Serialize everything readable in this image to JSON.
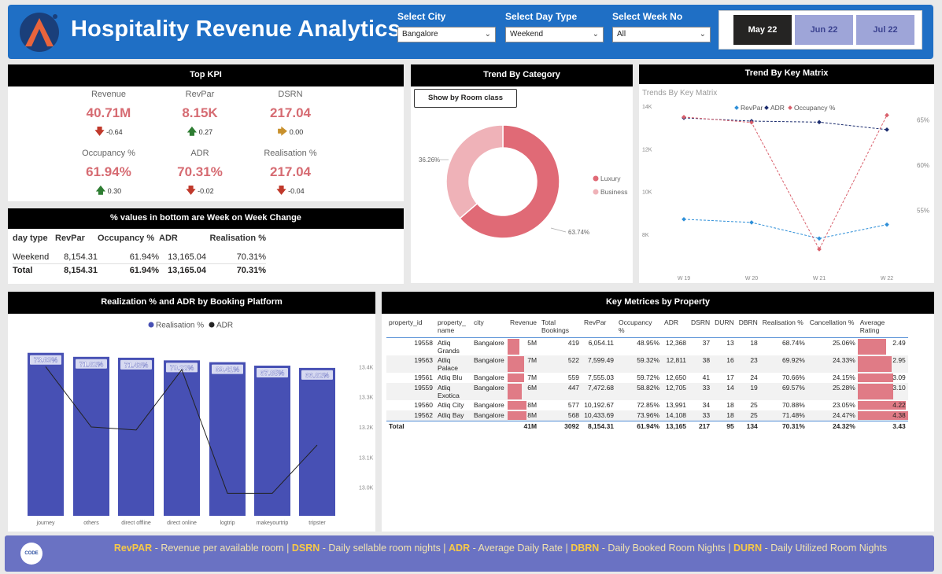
{
  "header": {
    "title": "Hospitality Revenue Analytics",
    "filters": [
      {
        "label": "Select City",
        "value": "Bangalore"
      },
      {
        "label": "Select Day Type",
        "value": "Weekend"
      },
      {
        "label": "Select Week No",
        "value": "All"
      }
    ],
    "months": [
      "May 22",
      "Jun 22",
      "Jul 22"
    ]
  },
  "top_kpi": {
    "title": "Top KPI",
    "items": [
      {
        "label": "Revenue",
        "value": "40.71M",
        "delta": "-0.64",
        "direction": "down"
      },
      {
        "label": "RevPar",
        "value": "8.15K",
        "delta": "0.27",
        "direction": "up"
      },
      {
        "label": "DSRN",
        "value": "217.04",
        "delta": "0.00",
        "direction": "flat"
      },
      {
        "label": "Occupancy %",
        "value": "61.94%",
        "delta": "0.30",
        "direction": "up"
      },
      {
        "label": "ADR",
        "value": "70.31%",
        "delta": "-0.02",
        "direction": "down"
      },
      {
        "label": "Realisation %",
        "value": "217.04",
        "delta": "-0.04",
        "direction": "down"
      }
    ]
  },
  "wow": {
    "title": "% values in bottom are Week on Week Change",
    "columns": [
      "day type",
      "RevPar",
      "Occupancy %",
      "ADR",
      "Realisation %"
    ],
    "rows": [
      [
        "Weekend",
        "8,154.31",
        "61.94%",
        "13,165.04",
        "70.31%"
      ]
    ],
    "total": [
      "Total",
      "8,154.31",
      "61.94%",
      "13,165.04",
      "70.31%"
    ]
  },
  "trend_category": {
    "title": "Trend By Category",
    "button": "Show by Room class"
  },
  "trend_matrix": {
    "title": "Trend By Key Matrix",
    "subtitle": "Trends By Key Matrix"
  },
  "realization": {
    "title": "Realization % and ADR by Booking Platform"
  },
  "property": {
    "title": "Key Metrices by Property",
    "columns": [
      "property_id",
      "property_ name",
      "city",
      "Revenue",
      "Total Bookings",
      "RevPar",
      "Occupancy %",
      "ADR",
      "DSRN",
      "DURN",
      "DBRN",
      "Realisation %",
      "Cancellation %",
      "Average Rating"
    ],
    "rows": [
      {
        "id": "19558",
        "name": "Atliq Grands",
        "city": "Bangalore",
        "revenue": "5M",
        "rev_frac": 0.625,
        "bookings": "419",
        "revpar": "6,054.11",
        "occ": "48.95%",
        "adr": "12,368",
        "dsrn": "37",
        "durn": "13",
        "dbrn": "18",
        "real": "68.74%",
        "cancel": "25.06%",
        "rating": "2.49",
        "rating_frac": 0.57
      },
      {
        "id": "19563",
        "name": "Atliq Palace",
        "city": "Bangalore",
        "revenue": "7M",
        "rev_frac": 0.875,
        "bookings": "522",
        "revpar": "7,599.49",
        "occ": "59.32%",
        "adr": "12,811",
        "dsrn": "38",
        "durn": "16",
        "dbrn": "23",
        "real": "69.92%",
        "cancel": "24.33%",
        "rating": "2.95",
        "rating_frac": 0.67
      },
      {
        "id": "19561",
        "name": "Atliq Blu",
        "city": "Bangalore",
        "revenue": "7M",
        "rev_frac": 0.875,
        "bookings": "559",
        "revpar": "7,555.03",
        "occ": "59.72%",
        "adr": "12,650",
        "dsrn": "41",
        "durn": "17",
        "dbrn": "24",
        "real": "70.66%",
        "cancel": "24.15%",
        "rating": "3.09",
        "rating_frac": 0.71
      },
      {
        "id": "19559",
        "name": "Atliq Exotica",
        "city": "Bangalore",
        "revenue": "6M",
        "rev_frac": 0.75,
        "bookings": "447",
        "revpar": "7,472.68",
        "occ": "58.82%",
        "adr": "12,705",
        "dsrn": "33",
        "durn": "14",
        "dbrn": "19",
        "real": "69.57%",
        "cancel": "25.28%",
        "rating": "3.10",
        "rating_frac": 0.71
      },
      {
        "id": "19560",
        "name": "Atliq City",
        "city": "Bangalore",
        "revenue": "8M",
        "rev_frac": 1.0,
        "bookings": "577",
        "revpar": "10,192.67",
        "occ": "72.85%",
        "adr": "13,991",
        "dsrn": "34",
        "durn": "18",
        "dbrn": "25",
        "real": "70.88%",
        "cancel": "23.05%",
        "rating": "4.22",
        "rating_frac": 0.96
      },
      {
        "id": "19562",
        "name": "Atliq Bay",
        "city": "Bangalore",
        "revenue": "8M",
        "rev_frac": 1.0,
        "bookings": "568",
        "revpar": "10,433.69",
        "occ": "73.96%",
        "adr": "14,108",
        "dsrn": "33",
        "durn": "18",
        "dbrn": "25",
        "real": "71.48%",
        "cancel": "24.47%",
        "rating": "4.38",
        "rating_frac": 1.0
      }
    ],
    "total": {
      "label": "Total",
      "revenue": "41M",
      "bookings": "3092",
      "revpar": "8,154.31",
      "occ": "61.94%",
      "adr": "13,165",
      "dsrn": "217",
      "durn": "95",
      "dbrn": "134",
      "real": "70.31%",
      "cancel": "24.32%",
      "rating": "3.43"
    }
  },
  "footer": {
    "logo_text": "CODE",
    "segments": [
      {
        "key": "RevPAR",
        "desc": " - Revenue per available room | "
      },
      {
        "key": "DSRN",
        "desc": " - Daily sellable room nights | "
      },
      {
        "key": "ADR",
        "desc": " - Average Daily Rate | "
      },
      {
        "key": "DBRN",
        "desc": " - Daily Booked Room Nights | "
      },
      {
        "key": "DURN",
        "desc": " - Daily Utilized Room Nights"
      }
    ]
  },
  "chart_data": [
    {
      "type": "pie",
      "title": "Trend By Category",
      "categories": [
        "Luxury",
        "Business"
      ],
      "values": [
        63.74,
        36.26
      ],
      "labels": [
        "63.74%",
        "36.26%"
      ],
      "colors": [
        "#e06a76",
        "#efb2b8"
      ],
      "donut": true,
      "legend": "right"
    },
    {
      "type": "line",
      "title": "Trends By Key Matrix",
      "x": [
        "W 19",
        "W 20",
        "W 21",
        "W 22"
      ],
      "legend": "top",
      "series": [
        {
          "name": "RevPar",
          "axis": "left",
          "color": "#2e8fd8",
          "values": [
            8700,
            8550,
            7800,
            8450
          ]
        },
        {
          "name": "ADR",
          "axis": "left",
          "color": "#1b2c6e",
          "values": [
            13450,
            13300,
            13250,
            12900
          ]
        },
        {
          "name": "Occupancy %",
          "axis": "right",
          "color": "#d9606c",
          "values": [
            65.3,
            64.7,
            50.7,
            65.5
          ]
        }
      ],
      "y_left": {
        "ticks": [
          "8K",
          "10K",
          "12K",
          "14K"
        ],
        "range": [
          7000,
          14000
        ]
      },
      "y_right": {
        "ticks": [
          "55%",
          "60%",
          "65%"
        ],
        "range": [
          50,
          66.5
        ]
      }
    },
    {
      "type": "bar",
      "title": "Realization % and ADR by Booking Platform",
      "categories": [
        "journey",
        "others",
        "direct offline",
        "direct online",
        "logtrip",
        "makeyourtrip",
        "tripster"
      ],
      "legend": "top",
      "series": [
        {
          "name": "Realisation %",
          "type": "bar",
          "color": "#4750b4",
          "values": [
            73.63,
            71.82,
            71.43,
            70.22,
            69.41,
            67.85,
            66.82
          ],
          "labels": [
            "73.63%",
            "71.82%",
            "71.43%",
            "70.22%",
            "69.41%",
            "67.85%",
            "66.82%"
          ]
        },
        {
          "name": "ADR",
          "type": "line",
          "color": "#222222",
          "values": [
            13.4,
            13.2,
            13.19,
            13.39,
            12.98,
            12.98,
            13.14
          ]
        }
      ],
      "y_right": {
        "ticks": [
          "13.0K",
          "13.1K",
          "13.2K",
          "13.3K",
          "13.4K"
        ],
        "range": [
          12.96,
          13.44
        ]
      }
    }
  ]
}
